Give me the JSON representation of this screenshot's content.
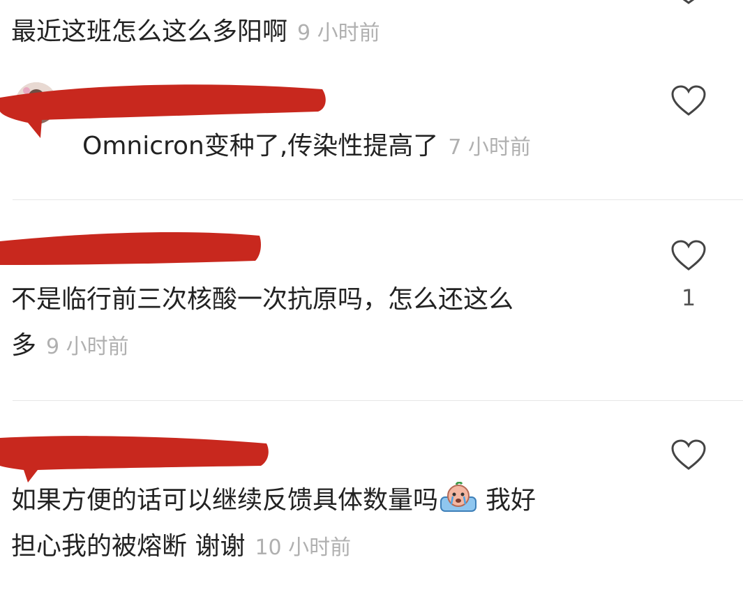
{
  "comments": [
    {
      "text": "最近这班怎么这么多阳啊",
      "time": "9 小时前"
    },
    {
      "text": "Omnicron变种了,传染性提高了",
      "time": "7 小时前"
    },
    {
      "text_line1": "不是临行前三次核酸一次抗原吗，怎么还这么",
      "text_line2": "多",
      "time": "9 小时前",
      "likes": "1"
    },
    {
      "text_line1": "如果方便的话可以继续反馈具体数量吗",
      "text_line1_after_emoji": "我好",
      "text_line2": "担心我的被熔断 谢谢",
      "time": "10 小时前"
    }
  ],
  "icons": {
    "like": "heart-outline-icon",
    "emoji": "crying-emoji-icon",
    "collapse": "chevron-down-icon",
    "avatar": "user-avatar"
  },
  "colors": {
    "redaction": "#c8281e",
    "timestamp": "#b0b0b0",
    "text": "#222222",
    "divider": "#e6e6e6"
  }
}
